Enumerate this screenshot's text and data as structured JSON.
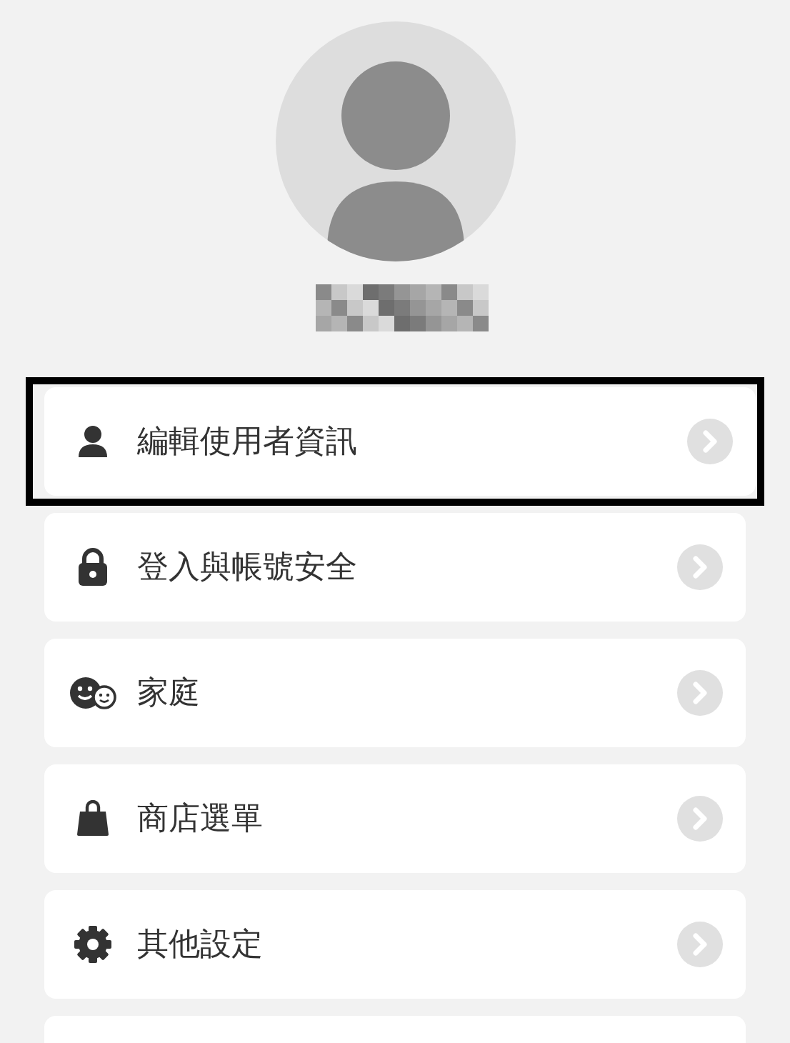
{
  "profile": {
    "avatar": {
      "kind": "default"
    }
  },
  "menu": [
    {
      "kind": "user",
      "label": "編輯使用者資訊",
      "highlighted": true
    },
    {
      "kind": "lock",
      "label": "登入與帳號安全",
      "highlighted": false
    },
    {
      "kind": "family",
      "label": "家庭",
      "highlighted": false
    },
    {
      "kind": "bag",
      "label": "商店選單",
      "highlighted": false
    },
    {
      "kind": "gear",
      "label": "其他設定",
      "highlighted": false
    }
  ]
}
